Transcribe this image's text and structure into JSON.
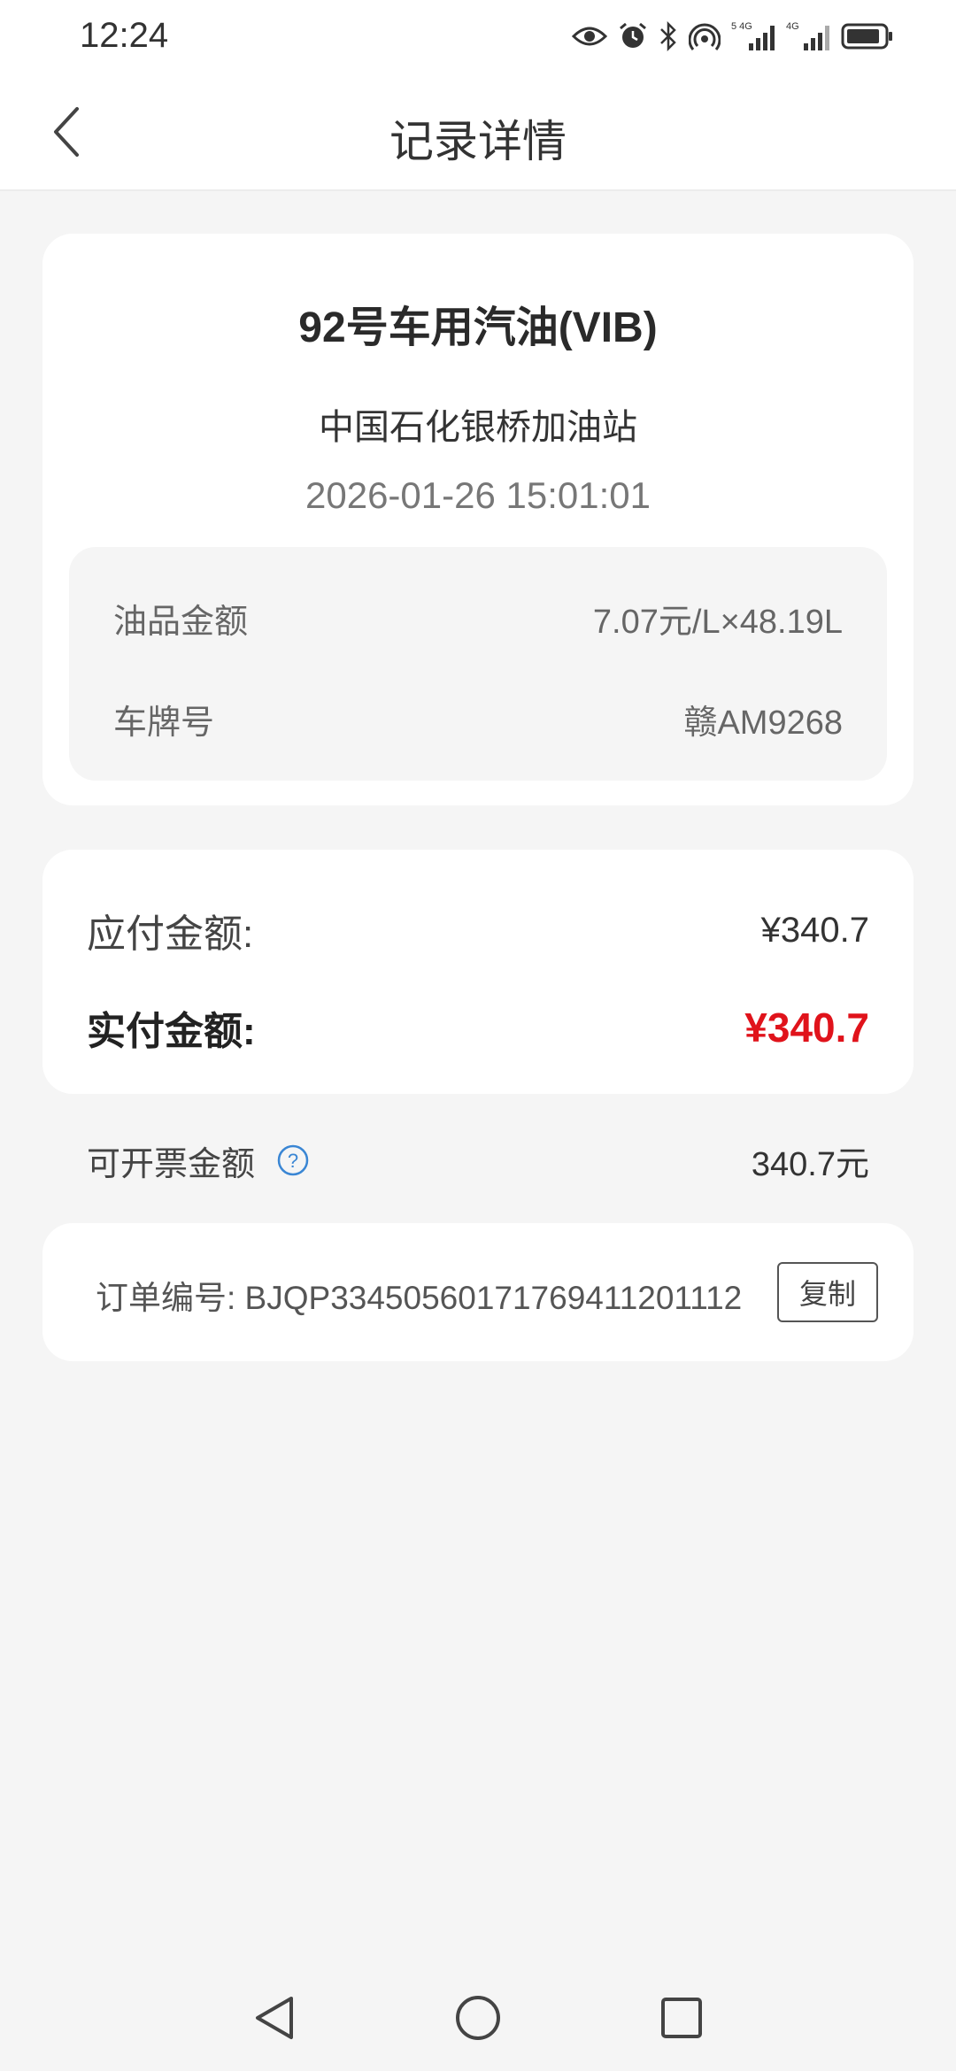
{
  "status_bar": {
    "time": "12:24",
    "icons": [
      "eye-icon",
      "alarm-icon",
      "bluetooth-icon",
      "hotspot-icon",
      "signal-5g-icon",
      "signal-4g-icon",
      "battery-icon"
    ],
    "signal_label_1": "5 4G",
    "signal_label_2": "4G"
  },
  "header": {
    "title": "记录详情",
    "back_icon": "chevron-left-icon"
  },
  "record": {
    "product": "92号车用汽油(VIB)",
    "station": "中国石化银桥加油站",
    "time": "2026-01-26 15:01:01",
    "details": [
      {
        "label": "油品金额",
        "value": "7.07元/L×48.19L"
      },
      {
        "label": "车牌号",
        "value": "赣AM9268"
      }
    ]
  },
  "payment": {
    "due_label": "应付金额:",
    "due_amount": "¥340.7",
    "actual_label": "实付金额:",
    "actual_amount": "¥340.7",
    "actual_color": "#e0131b"
  },
  "invoice": {
    "label": "可开票金额",
    "help_icon": "question-circle-icon",
    "amount": "340.7元"
  },
  "order": {
    "label": "订单编号: BJQP334505601717694112011​12",
    "copy_label": "复制"
  },
  "system_nav": {
    "back": "triangle-back-icon",
    "home": "circle-home-icon",
    "recent": "square-recent-icon"
  }
}
